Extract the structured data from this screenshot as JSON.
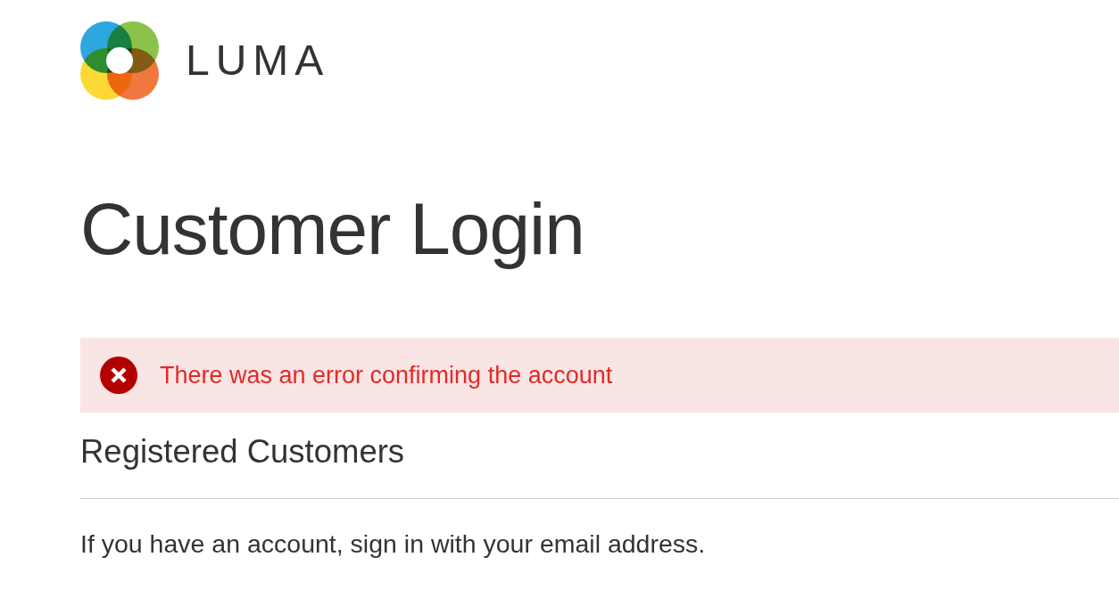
{
  "logo": {
    "wordmark": "LUMA"
  },
  "page_title": "Customer Login",
  "messages": [
    {
      "kind": "error",
      "text": "There was an error confirming the account"
    }
  ],
  "login_block": {
    "title": "Registered Customers",
    "note": "If you have an account, sign in with your email address."
  }
}
